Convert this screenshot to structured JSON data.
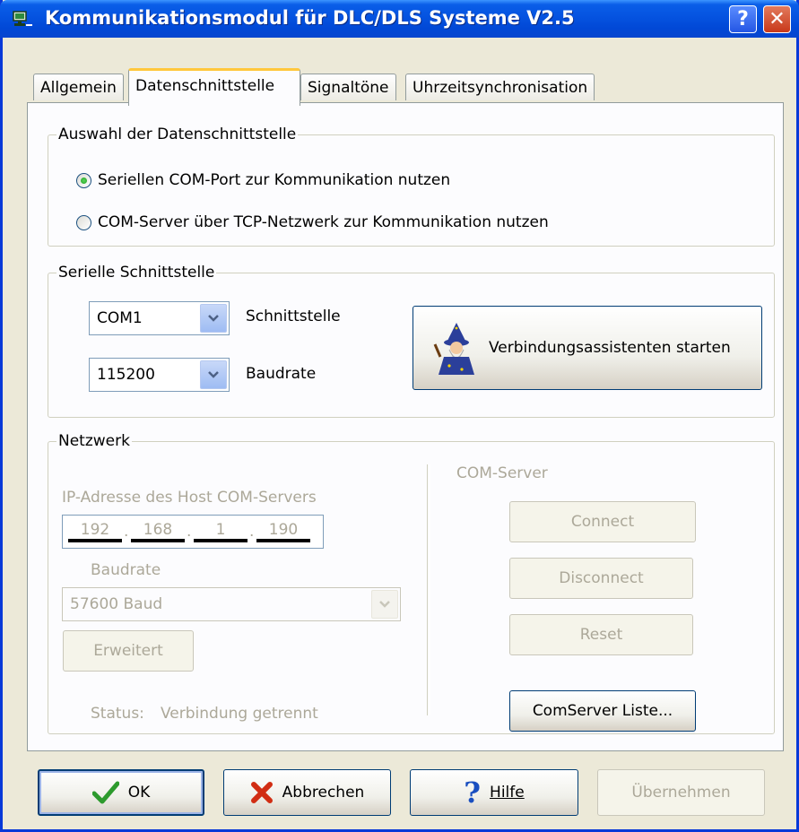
{
  "window": {
    "title": "Kommunikationsmodul für DLC/DLS Systeme V2.5",
    "help_btn": "?",
    "close_btn": "✕"
  },
  "tabs": [
    {
      "label": "Allgemein",
      "active": false
    },
    {
      "label": "Datenschnittstelle",
      "active": true
    },
    {
      "label": "Signaltöne",
      "active": false
    },
    {
      "label": "Uhrzeitsynchronisation",
      "active": false
    }
  ],
  "auswahl": {
    "title": "Auswahl der Datenschnittstelle",
    "option_serial": "Seriellen COM-Port zur Kommunikation nutzen",
    "option_tcp": "COM-Server über TCP-Netzwerk zur Kommunikation nutzen",
    "selected": "serial"
  },
  "serial": {
    "title": "Serielle Schnittstelle",
    "port_value": "COM1",
    "port_label": "Schnittstelle",
    "baud_value": "115200",
    "baud_label": "Baudrate",
    "wizard_button": "Verbindungsassistenten starten"
  },
  "network": {
    "title": "Netzwerk",
    "ip_label": "IP-Adresse des Host COM-Servers",
    "ip": [
      "192",
      "168",
      "1",
      "190"
    ],
    "ip_dot": ".",
    "baud_label": "Baudrate",
    "baud_value": "57600 Baud",
    "advanced_button": "Erweitert",
    "status_label": "Status:",
    "status_value": "Verbindung getrennt",
    "comserver_label": "COM-Server",
    "connect_button": "Connect",
    "disconnect_button": "Disconnect",
    "reset_button": "Reset",
    "list_button": "ComServer Liste..."
  },
  "footer": {
    "ok": "OK",
    "cancel": "Abbrechen",
    "help": "Hilfe",
    "apply": "Übernehmen"
  },
  "colors": {
    "titlebar": "#0553e0",
    "window_bg": "#ece9d8",
    "disabled_text": "#aca899",
    "ok_check": "#2d9a2d",
    "cancel_x": "#d12d13",
    "help_q": "#1a4fc0"
  }
}
